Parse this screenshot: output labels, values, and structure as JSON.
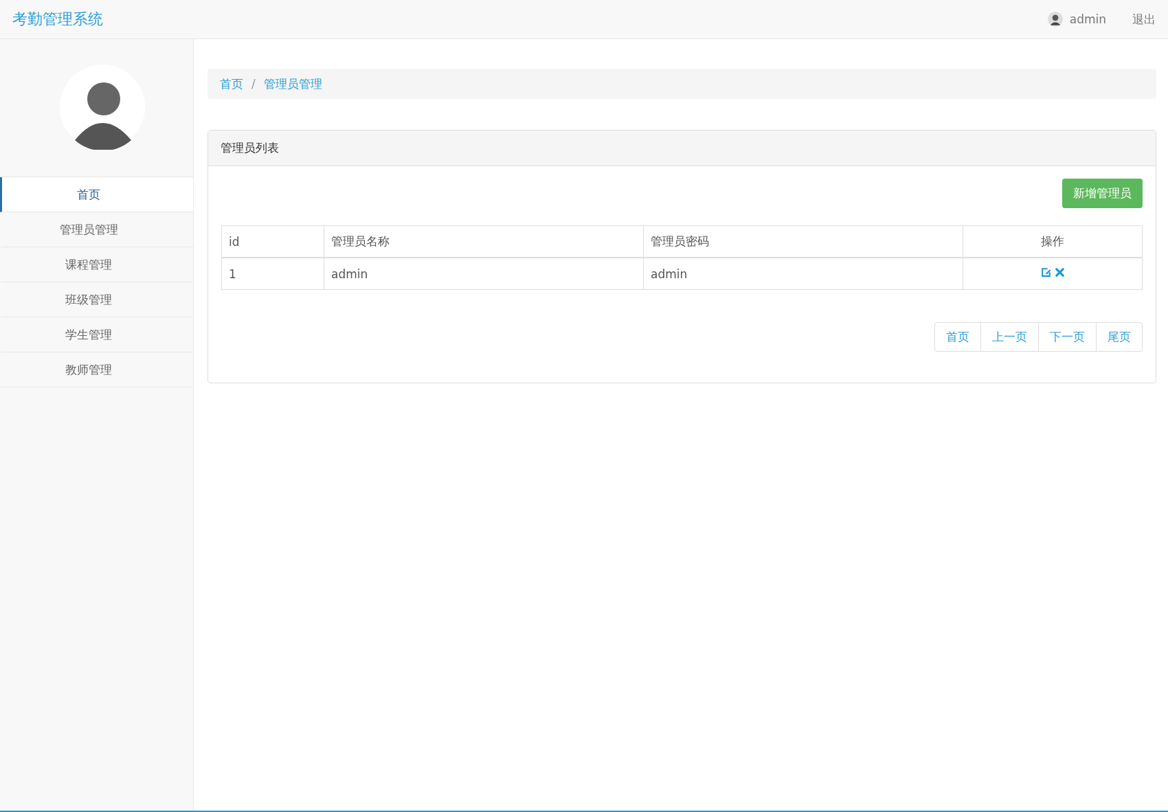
{
  "header": {
    "brand": "考勤管理系统",
    "user": "admin",
    "logout": "退出"
  },
  "sidebar": {
    "items": [
      {
        "label": "首页",
        "selected": true
      },
      {
        "label": "管理员管理",
        "selected": false
      },
      {
        "label": "课程管理",
        "selected": false
      },
      {
        "label": "班级管理",
        "selected": false
      },
      {
        "label": "学生管理",
        "selected": false
      },
      {
        "label": "教师管理",
        "selected": false
      }
    ]
  },
  "breadcrumb": [
    "首页",
    "管理员管理"
  ],
  "breadcrumb_separator": "/",
  "panel": {
    "title": "管理员列表",
    "add_button": "新增管理员",
    "table": {
      "columns": [
        "id",
        "管理员名称",
        "管理员密码",
        "操作"
      ],
      "rows": [
        {
          "cells": [
            "1",
            "admin",
            "admin"
          ]
        }
      ]
    },
    "pagination": [
      "首页",
      "上一页",
      "下一页",
      "尾页"
    ]
  }
}
